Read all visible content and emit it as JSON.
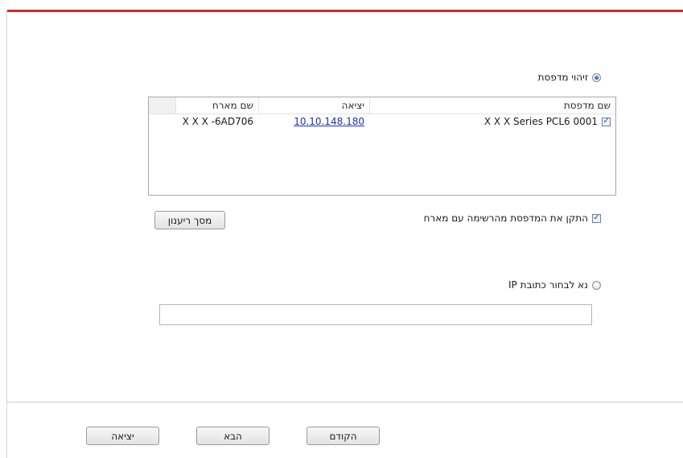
{
  "identify_printer": {
    "label": "זיהוי מדפסת",
    "selected": true
  },
  "table": {
    "headers": {
      "name": "שם מדפסת",
      "port": "יציאה",
      "host": "שם מארח"
    },
    "rows": [
      {
        "checked": true,
        "name": "X X X  Series PCL6 0001",
        "port": "10.10.148.180",
        "host": "X X X -6AD706"
      }
    ]
  },
  "install_checkbox": {
    "label": "התקן את המדפסת מהרשימה עם מארח",
    "checked": true
  },
  "refresh_button": "מסך ריענון",
  "select_ip": {
    "label": "נא לבחור כתובת IP",
    "selected": false
  },
  "ip_input": {
    "value": "",
    "placeholder": ""
  },
  "footer": {
    "back": "הקודם",
    "next": "הבא",
    "exit": "יציאה"
  },
  "colors": {
    "accent_top_border": "#d7262d",
    "link": "#1a33b8"
  }
}
